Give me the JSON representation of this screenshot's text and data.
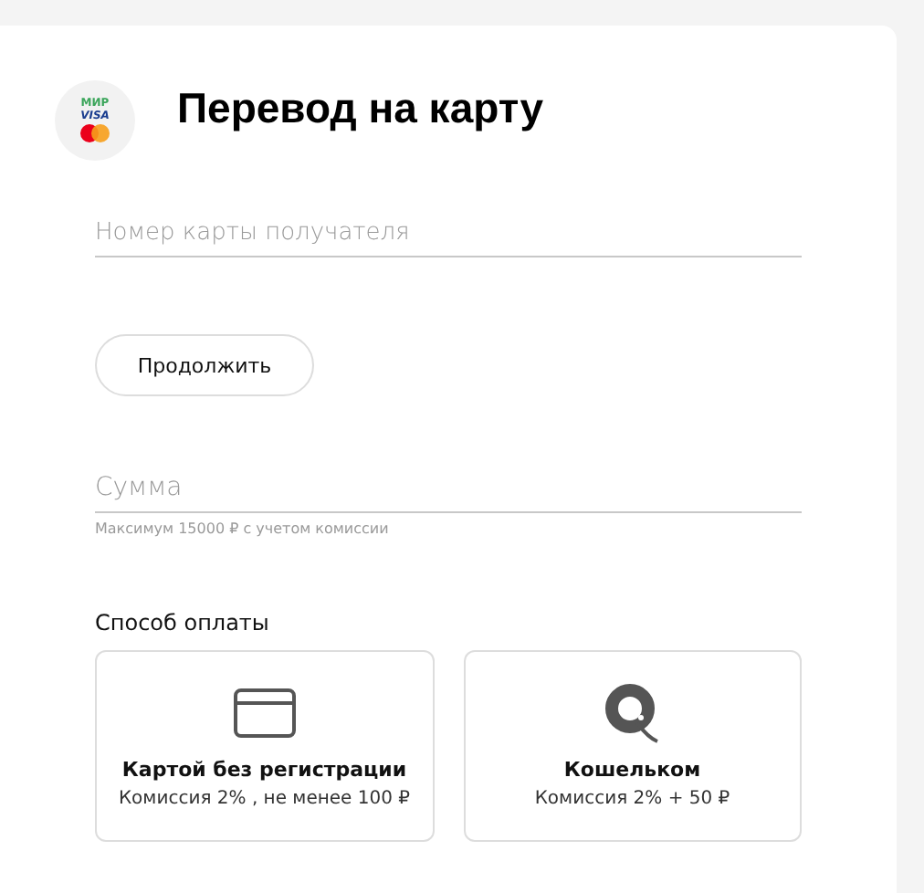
{
  "logo": {
    "labels": [
      "МИР",
      "VISA"
    ]
  },
  "title": "Перевод на карту",
  "card_field": {
    "placeholder": "Номер карты получателя"
  },
  "continue_button": "Продолжить",
  "amount_field": {
    "placeholder": "Сумма",
    "hint": "Максимум 15000 ₽ с учетом комиссии"
  },
  "payment_method": {
    "heading": "Способ оплаты",
    "options": [
      {
        "kind": "card",
        "title": "Картой без регистрации",
        "fee": "Комиссия 2% , не менее 100 ₽"
      },
      {
        "kind": "wallet",
        "title": "Кошельком",
        "fee": "Комиссия 2% + 50 ₽"
      }
    ]
  }
}
